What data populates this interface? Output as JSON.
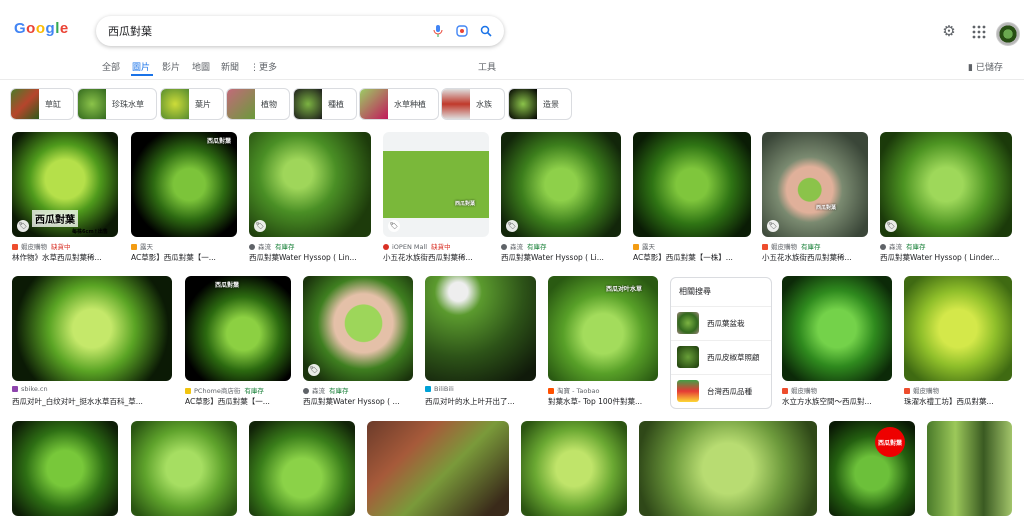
{
  "header": {
    "logo": "Google",
    "query": "西瓜對葉",
    "colors": {
      "blue": "#4285f4",
      "red": "#ea4335",
      "yellow": "#fbbc05",
      "green": "#34a853"
    }
  },
  "tabs": [
    {
      "label": "全部"
    },
    {
      "label": "圖片"
    },
    {
      "label": "影片"
    },
    {
      "label": "地圖"
    },
    {
      "label": "新聞"
    },
    {
      "label": "更多"
    }
  ],
  "tools_label": "工具",
  "saved_label": "已儲存",
  "chips": [
    {
      "label": "草缸"
    },
    {
      "label": "珍珠水草"
    },
    {
      "label": "葉片"
    },
    {
      "label": "植物"
    },
    {
      "label": "種植"
    },
    {
      "label": "水草种植"
    },
    {
      "label": "水族"
    },
    {
      "label": "造景"
    }
  ],
  "results": [
    {
      "source": "蝦皮購物",
      "badge": "缺貨中",
      "title": "林作物》水草西瓜對葉稀...",
      "overlay": "西瓜對葉",
      "overlay_sub": "每株6cm↑出售"
    },
    {
      "source": "露天",
      "title": "AC草影】西瓜對葉【一...",
      "overlay": "西瓜對葉"
    },
    {
      "source": "森流",
      "stock": "有庫存",
      "title": "西瓜對葉Water Hyssop ( Lin..."
    },
    {
      "source": "iOPEN Mall",
      "badge": "缺貨中",
      "title": "小五花水族街西瓜對葉稀...",
      "overlay": "西瓜對葉"
    },
    {
      "source": "森流",
      "stock": "有庫存",
      "title": "西瓜對葉Water Hyssop ( Li..."
    },
    {
      "source": "露天",
      "title": "AC草影】西瓜對葉【一株】..."
    },
    {
      "source": "蝦皮購物",
      "stock": "有庫存",
      "title": "小五花水族街西瓜對葉稀...",
      "overlay": "西瓜對葉"
    },
    {
      "source": "森流",
      "stock": "有庫存",
      "title": "西瓜對葉Water Hyssop ( Linder..."
    },
    {
      "source": "sbike.cn",
      "title": "西瓜对叶_白纹对叶_挺水水草百科_草..."
    },
    {
      "source": "PChome商店街",
      "stock": "有庫存",
      "title": "AC草影】西瓜對葉【一...",
      "overlay": "西瓜對葉"
    },
    {
      "source": "森流",
      "stock": "有庫存",
      "title": "西瓜對葉Water Hyssop ( ..."
    },
    {
      "source": "BiliBili",
      "title": "西瓜对叶的水上叶开出了..."
    },
    {
      "source": "淘寶 - Taobao",
      "title": "對葉水草- Top 100件對葉...",
      "overlay": "西瓜对叶水草"
    },
    {
      "source": "蝦皮購物",
      "title": "水立方水族空間～西瓜對..."
    },
    {
      "source": "蝦皮購物",
      "title": "珠濯水禮工坊】西瓜對葉..."
    },
    {
      "source": ""
    },
    {
      "source": ""
    },
    {
      "source": ""
    },
    {
      "source": ""
    },
    {
      "source": ""
    },
    {
      "source": ""
    },
    {
      "source": "",
      "overlay": "西瓜對葉"
    },
    {
      "source": ""
    }
  ],
  "related": {
    "title": "相關搜尋",
    "items": [
      {
        "label": "西瓜葉盆栽"
      },
      {
        "label": "西瓜皮椒草照顧"
      },
      {
        "label": "台灣西瓜品種"
      }
    ]
  }
}
